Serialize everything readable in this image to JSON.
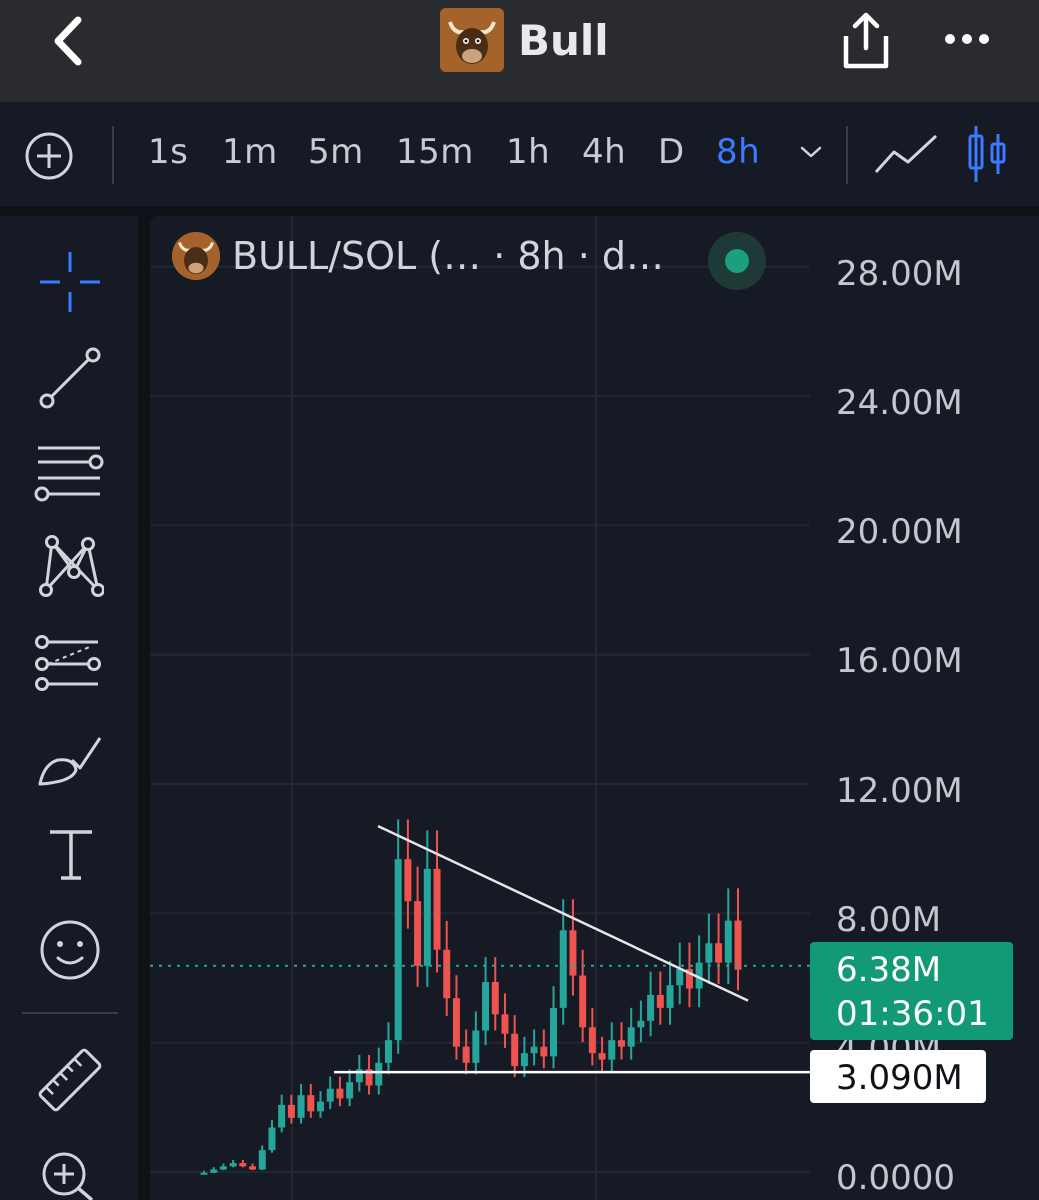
{
  "header": {
    "title": "Bull",
    "icons": {
      "back": "chevron-left-icon",
      "share": "share-icon",
      "more": "more-horizontal-icon"
    }
  },
  "timeframes": {
    "items": [
      "1s",
      "1m",
      "5m",
      "15m",
      "1h",
      "4h",
      "D",
      "8h"
    ],
    "active": "8h",
    "accent": "#3c7bff"
  },
  "left_tools": [
    "crosshair-icon",
    "trend-line-icon",
    "fib-retracement-icon",
    "pattern-icon",
    "projection-icon",
    "brush-icon",
    "text-icon",
    "emoji-icon",
    "ruler-icon",
    "zoom-in-icon"
  ],
  "chart": {
    "legend_text": "BULL/SOL (… · 8h · d…",
    "live_color": "#1aa07e",
    "y_axis_labels": [
      "28.00M",
      "24.00M",
      "20.00M",
      "16.00M",
      "12.00M",
      "8.00M",
      "4.00M",
      "0.0000"
    ],
    "current_price": "6.38M",
    "countdown": "01:36:01",
    "horizontal_level": "3.090M",
    "up_color": "#26a69a",
    "down_color": "#ef5350"
  },
  "chart_data": {
    "type": "candlestick",
    "y_axis": {
      "min": 0,
      "max": 28,
      "unit": "M",
      "ticks": [
        0,
        4,
        8,
        12,
        16,
        20,
        24,
        28
      ]
    },
    "current_price": 6.38,
    "support_level": 3.09,
    "descending_trendline": {
      "from": 10.7,
      "to": 5.3
    },
    "close_series": [
      0.1,
      0.2,
      0.3,
      0.4,
      0.3,
      0.2,
      0.8,
      1.5,
      2.2,
      1.8,
      2.5,
      2.0,
      2.3,
      2.7,
      2.4,
      2.9,
      3.3,
      2.8,
      3.5,
      4.2,
      9.8,
      8.5,
      6.5,
      9.5,
      7.0,
      5.5,
      4.0,
      3.5,
      4.5,
      6.0,
      5.0,
      4.4,
      3.4,
      3.8,
      4.0,
      3.7,
      5.2,
      7.6,
      6.2,
      4.6,
      3.8,
      3.6,
      4.2,
      4.0,
      4.6,
      4.8,
      5.6,
      5.2,
      5.9,
      6.4,
      5.8,
      6.6,
      7.2,
      6.6,
      7.9,
      6.38
    ]
  }
}
